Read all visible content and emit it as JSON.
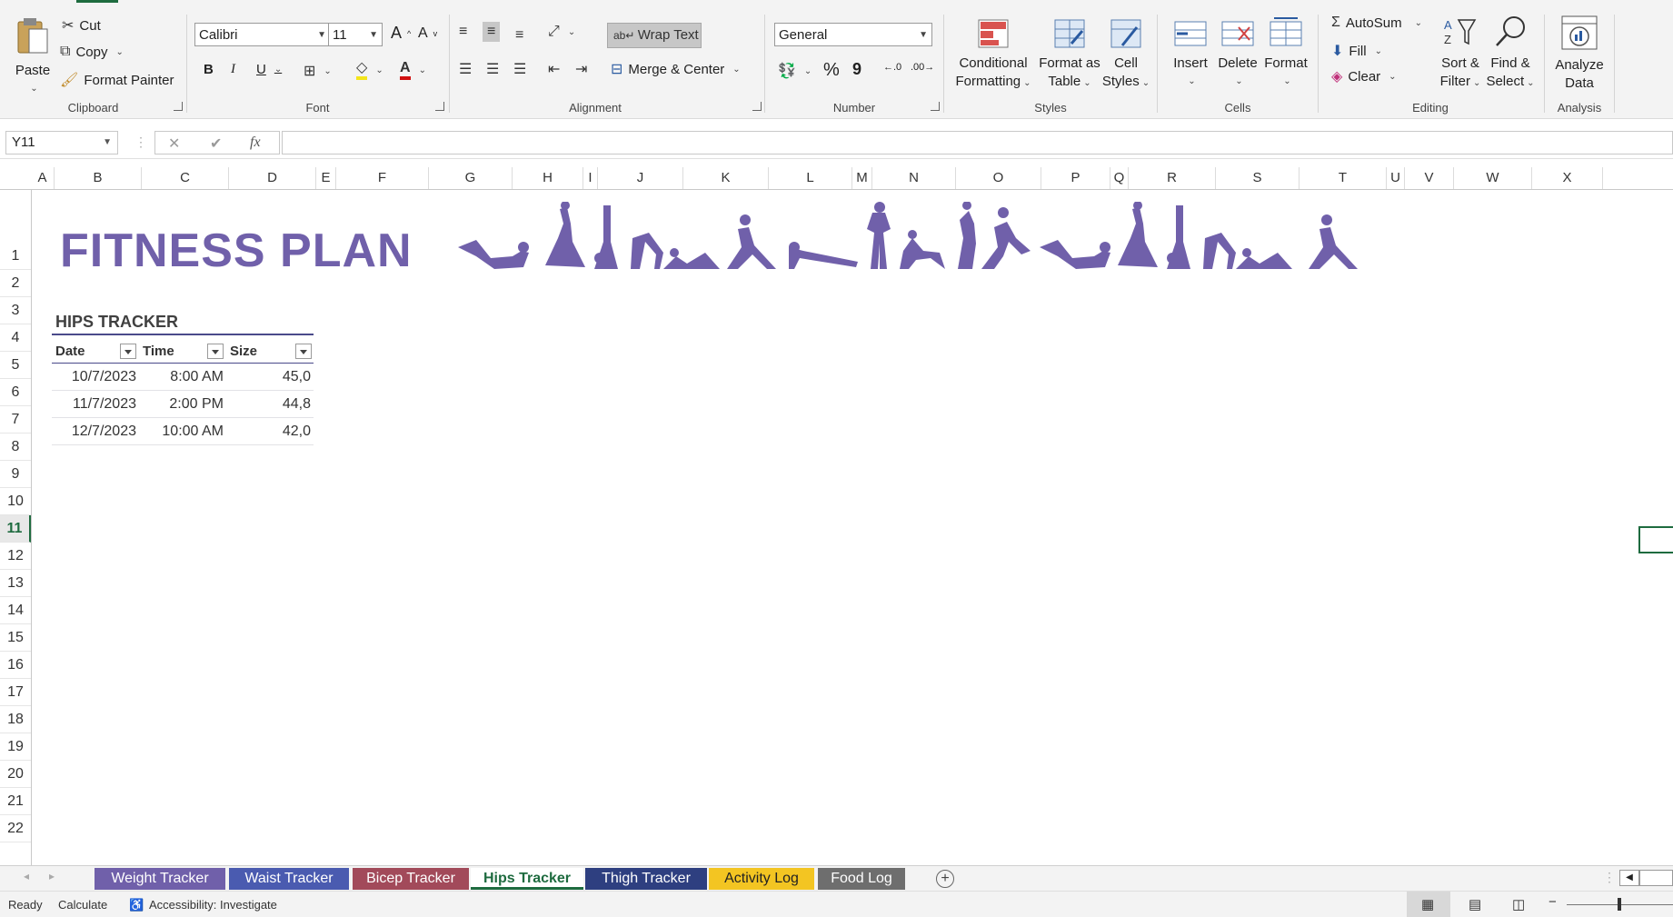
{
  "ribbon": {
    "clipboard": {
      "paste": "Paste",
      "cut": "Cut",
      "copy": "Copy",
      "format_painter": "Format Painter",
      "label": "Clipboard"
    },
    "font": {
      "name": "Calibri",
      "size": "11",
      "bold": "B",
      "italic": "I",
      "underline": "U",
      "label": "Font"
    },
    "alignment": {
      "wrap_text": "Wrap Text",
      "merge_center": "Merge & Center",
      "label": "Alignment"
    },
    "number": {
      "format": "General",
      "percent": "%",
      "comma": "9",
      "label": "Number"
    },
    "styles": {
      "conditional_1": "Conditional",
      "conditional_2": "Formatting",
      "format_table_1": "Format as",
      "format_table_2": "Table",
      "cell_styles_1": "Cell",
      "cell_styles_2": "Styles",
      "label": "Styles"
    },
    "cells": {
      "insert": "Insert",
      "delete": "Delete",
      "format": "Format",
      "label": "Cells"
    },
    "editing": {
      "autosum": "AutoSum",
      "fill": "Fill",
      "clear": "Clear",
      "sort_1": "Sort &",
      "sort_2": "Filter",
      "find_1": "Find &",
      "find_2": "Select",
      "label": "Editing"
    },
    "analysis": {
      "analyze_1": "Analyze",
      "analyze_2": "Data",
      "label": "Analysis"
    }
  },
  "formula_bar": {
    "name_box": "Y11",
    "fx": "fx",
    "content": ""
  },
  "columns": [
    "A",
    "B",
    "C",
    "D",
    "E",
    "F",
    "G",
    "H",
    "I",
    "J",
    "K",
    "L",
    "M",
    "N",
    "O",
    "P",
    "Q",
    "R",
    "S",
    "T",
    "U",
    "V",
    "W",
    "X"
  ],
  "rows": [
    "1",
    "2",
    "3",
    "4",
    "5",
    "6",
    "7",
    "8",
    "9",
    "10",
    "11",
    "12",
    "13",
    "14",
    "15",
    "16",
    "17",
    "18",
    "19",
    "20",
    "21",
    "22"
  ],
  "sheet": {
    "title": "FITNESS PLAN",
    "table_title": "HIPS TRACKER",
    "headers": [
      "Date",
      "Time",
      "Size"
    ],
    "table_rows": [
      [
        "10/7/2023",
        "8:00 AM",
        "45,0"
      ],
      [
        "11/7/2023",
        "2:00 PM",
        "44,8"
      ],
      [
        "12/7/2023",
        "10:00 AM",
        "42,0"
      ]
    ]
  },
  "tabs": [
    {
      "label": "Weight Tracker",
      "color": "#7060aa"
    },
    {
      "label": "Waist Tracker",
      "color": "#4a5bb0"
    },
    {
      "label": "Bicep Tracker",
      "color": "#a24a5a"
    },
    {
      "label": "Hips Tracker",
      "color": "#ffffff"
    },
    {
      "label": "Thigh Tracker",
      "color": "#2e3f80"
    },
    {
      "label": "Activity Log",
      "color": "#f3c522"
    },
    {
      "label": "Food Log",
      "color": "#6e6e6e"
    }
  ],
  "status": {
    "ready": "Ready",
    "calculate": "Calculate",
    "accessibility": "Accessibility: Investigate"
  },
  "colors": {
    "accent": "#7060aa",
    "excel_green": "#1e6b3f"
  }
}
